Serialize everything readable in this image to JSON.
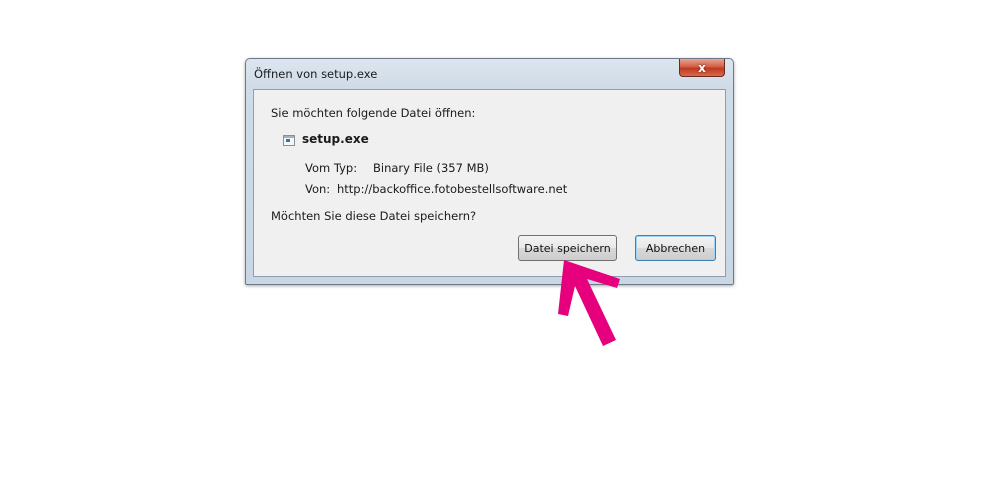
{
  "window": {
    "title": "Öffnen von setup.exe",
    "close_glyph": "x"
  },
  "dialog": {
    "prompt": "Sie möchten folgende Datei öffnen:",
    "file_icon": "file-icon",
    "filename": "setup.exe",
    "type_label": "Vom Typ:",
    "type_value": "Binary File (357 MB)",
    "from_label": "Von:",
    "from_value": "http://backoffice.fotobestellsoftware.net",
    "question": "Möchten Sie diese Datei speichern?"
  },
  "buttons": {
    "save_label": "Datei speichern",
    "cancel_label": "Abbrechen"
  },
  "annotation": {
    "arrow_icon": "arrow-pointer-icon",
    "arrow_color": "#e6007e"
  },
  "colors": {
    "close_button": "#c7432a",
    "default_button_border": "#3c7fb1",
    "dialog_background": "#f0f0f0"
  }
}
